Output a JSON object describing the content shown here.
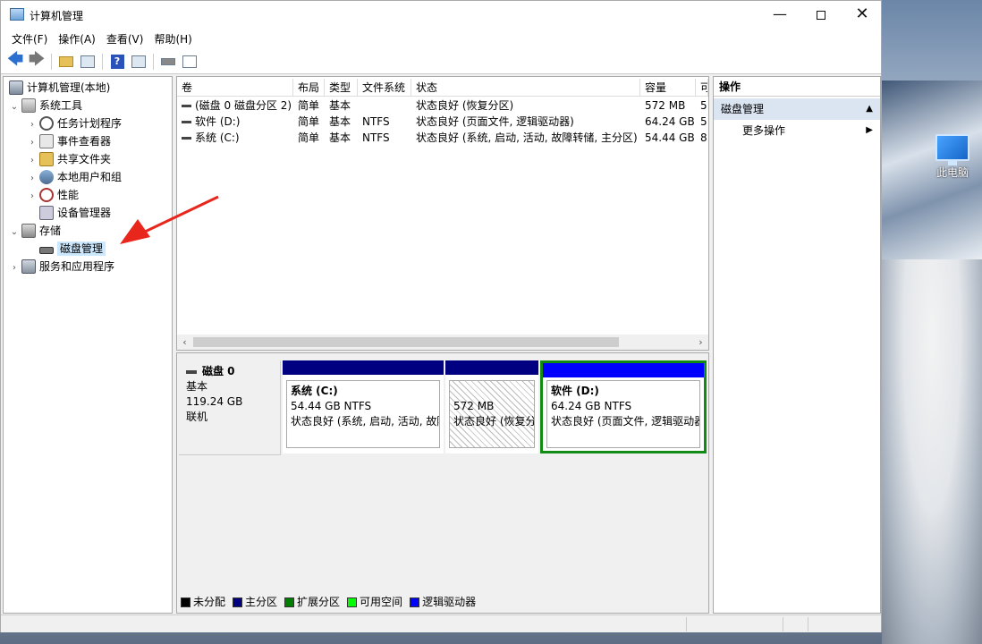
{
  "window": {
    "title": "计算机管理",
    "minimize": "—",
    "close": "✕"
  },
  "menu": [
    "文件(F)",
    "操作(A)",
    "查看(V)",
    "帮助(H)"
  ],
  "toolbar": {
    "back": "🡄",
    "forward": "🡆",
    "help": "?"
  },
  "tree": {
    "root": "计算机管理(本地)",
    "system_tools": "系统工具",
    "task_scheduler": "任务计划程序",
    "event_viewer": "事件查看器",
    "shared_folders": "共享文件夹",
    "local_users": "本地用户和组",
    "performance": "性能",
    "device_manager": "设备管理器",
    "storage": "存储",
    "disk_management": "磁盘管理",
    "services": "服务和应用程序"
  },
  "volumes": {
    "columns": [
      "卷",
      "布局",
      "类型",
      "文件系统",
      "状态",
      "容量",
      "可"
    ],
    "rows": [
      {
        "volume": "(磁盘 0 磁盘分区 2)",
        "layout": "简单",
        "type": "基本",
        "fs": "",
        "status": "状态良好 (恢复分区)",
        "capacity": "572 MB",
        "free": "5"
      },
      {
        "volume": "软件 (D:)",
        "layout": "简单",
        "type": "基本",
        "fs": "NTFS",
        "status": "状态良好 (页面文件, 逻辑驱动器)",
        "capacity": "64.24 GB",
        "free": "5"
      },
      {
        "volume": "系统 (C:)",
        "layout": "简单",
        "type": "基本",
        "fs": "NTFS",
        "status": "状态良好 (系统, 启动, 活动, 故障转储, 主分区)",
        "capacity": "54.44 GB",
        "free": "8"
      }
    ]
  },
  "disk": {
    "name": "磁盘 0",
    "kind": "基本",
    "size": "119.24 GB",
    "state": "联机",
    "partitions": [
      {
        "name": "系统  (C:)",
        "size": "54.44 GB NTFS",
        "status": "状态良好 (系统, 启动, 活动, 故障转储, 主分区)",
        "color": "#000080"
      },
      {
        "name": "",
        "size": "572 MB",
        "status": "状态良好 (恢复分区)",
        "color": "#000080"
      },
      {
        "name": "软件  (D:)",
        "size": "64.24 GB NTFS",
        "status": "状态良好 (页面文件, 逻辑驱动器)",
        "color": "#0000ff"
      }
    ]
  },
  "legend": [
    {
      "label": "未分配",
      "color": "#000000"
    },
    {
      "label": "主分区",
      "color": "#000080"
    },
    {
      "label": "扩展分区",
      "color": "#008000"
    },
    {
      "label": "可用空间",
      "color": "#00ff00"
    },
    {
      "label": "逻辑驱动器",
      "color": "#0000ff"
    }
  ],
  "actions": {
    "header": "操作",
    "section": "磁盘管理",
    "more": "更多操作"
  },
  "desktop": {
    "this_pc": "此电脑"
  },
  "colors": {
    "selected_partition_border": "#138a13",
    "annotation_arrow": "#e8261c"
  }
}
